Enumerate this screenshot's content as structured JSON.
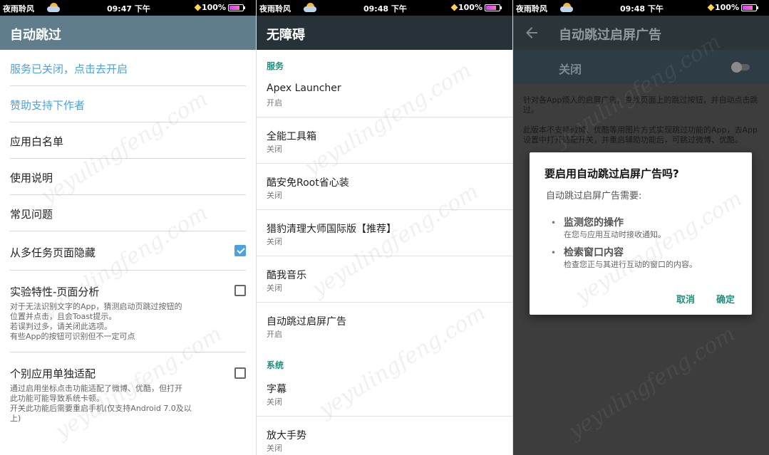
{
  "status_bars": [
    {
      "carrier": "夜雨聆风",
      "time": "09:47 下午",
      "battery": "100%"
    },
    {
      "carrier": "夜雨聆风",
      "time": "09:48 下午",
      "battery": "100%"
    },
    {
      "carrier": "夜雨聆风",
      "time": "09:48 下午",
      "battery": "100%"
    }
  ],
  "panel1": {
    "title": "自动跳过",
    "service_link": "服务已关闭，点击去开启",
    "sponsor_link": "赞助支持下作者",
    "whitelist": "应用白名单",
    "instructions": "使用说明",
    "faq": "常见问题",
    "hide_recents": {
      "label": "从多任务页面隐藏",
      "checked": true
    },
    "experimental": {
      "label": "实验特性-页面分析",
      "desc": "对于无法识别文字的App，猜测启动页跳过按钮的\n位置并点击，且会Toast提示。\n若误判过多，请关闭此选项。\n有些App的按钮可识别但不一定可点",
      "checked": false
    },
    "per_app": {
      "label": "个别应用单独适配",
      "desc": "通过启用坐标点击功能适配了微博、优酷，但打开\n此功能可能导致系统卡顿。\n开关此功能后需要重启手机(仅支持Android 7.0及以\n上)",
      "checked": false
    }
  },
  "panel2": {
    "title": "无障碍",
    "section_services": "服务",
    "services": [
      {
        "name": "Apex Launcher",
        "status": "开启"
      },
      {
        "name": "全能工具箱",
        "status": "关闭"
      },
      {
        "name": "酷安免Root省心装",
        "status": "关闭"
      },
      {
        "name": "猎豹清理大师国际版【推荐】",
        "status": "关闭"
      },
      {
        "name": "酷我音乐",
        "status": "关闭"
      },
      {
        "name": "自动跳过启屏广告",
        "status": "开启"
      }
    ],
    "section_system": "系统",
    "system": [
      {
        "name": "字幕",
        "status": "关闭"
      },
      {
        "name": "放大手势",
        "status": "关闭"
      }
    ]
  },
  "panel3": {
    "title": "自动跳过启屏广告",
    "toggle_label": "关闭",
    "toggle_on": false,
    "desc1": "针对各App烦人的启屏广告，查找页面上的跳过按钮，并自动点击跳过。",
    "desc2": "此版本不支持微博、优酷等用图片方式实现跳过功能的App，去App 设置中打开适配开关，并重启辅助功能后，可跳过微博、优酷。",
    "dialog": {
      "title": "要启用自动跳过启屏广告吗?",
      "intro": "自动跳过启屏广告需要:",
      "items": [
        {
          "heading": "监测您的操作",
          "detail": "在您与应用互动时接收通知。"
        },
        {
          "heading": "检索窗口内容",
          "detail": "检查您正与其进行互动的窗口的内容。"
        }
      ],
      "cancel": "取消",
      "ok": "确定"
    }
  },
  "watermark": "yeyulingfeng.com",
  "colors": {
    "panel1_appbar": "#607d8b",
    "panel2_appbar": "#263238",
    "link_blue": "#4aa3df",
    "accent_teal": "#1e8f7e",
    "dim_overlay": "#3d3d3d"
  },
  "icons": [
    "back-arrow-icon",
    "weather-cloud-icon",
    "battery-icon",
    "signal-diamond-icon",
    "checkbox-icon",
    "toggle-switch"
  ]
}
